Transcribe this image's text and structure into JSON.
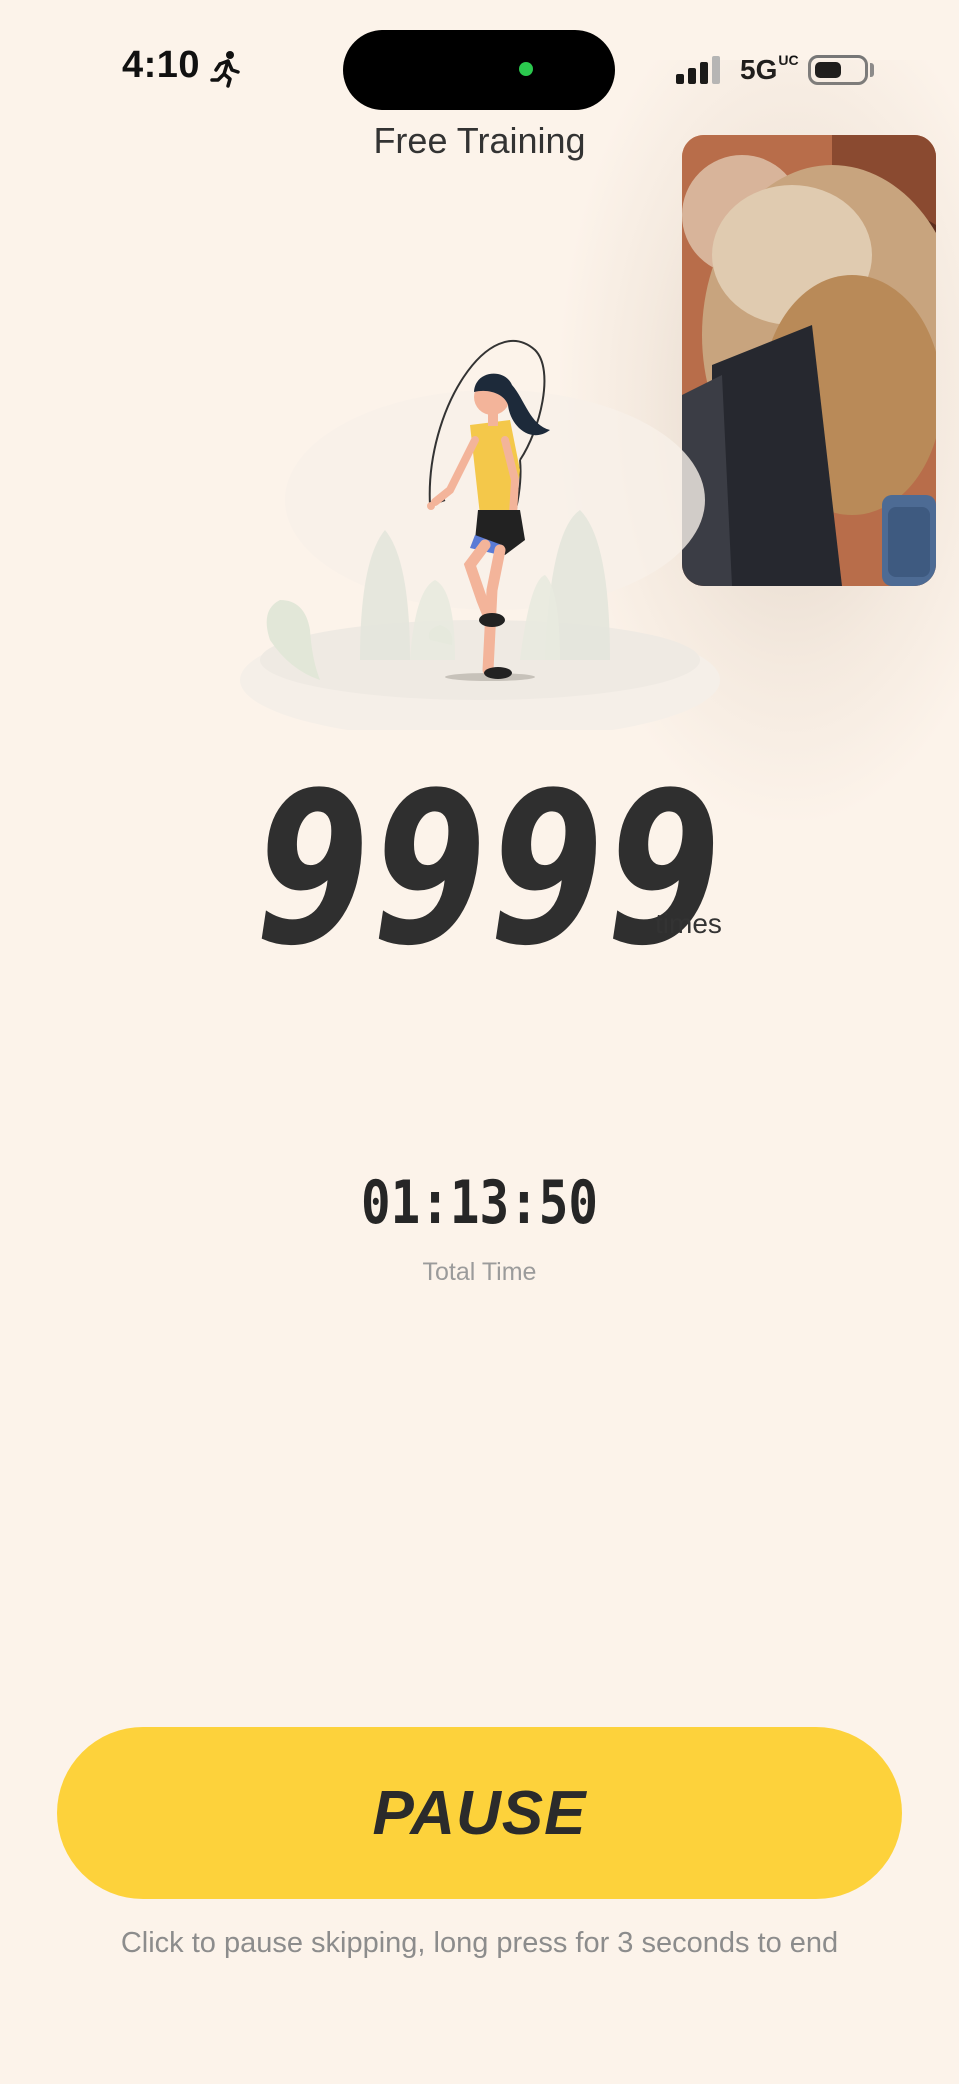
{
  "status_bar": {
    "time": "4:10",
    "network": "5G",
    "network_suffix": "UC",
    "activity_icon": "running-person-icon",
    "camera_indicator_color": "#2bc84e"
  },
  "header": {
    "title": "Free Training"
  },
  "counter": {
    "value": "9999",
    "unit": "times"
  },
  "timer": {
    "value": "01:13:50",
    "label": "Total Time"
  },
  "action": {
    "pause_label": "PAUSE",
    "hint": "Click to pause skipping, long press for 3 seconds to end"
  },
  "colors": {
    "background": "#fcf3ea",
    "accent": "#fdd23b",
    "text": "#2e2e2e",
    "muted": "#9b9b9b"
  }
}
